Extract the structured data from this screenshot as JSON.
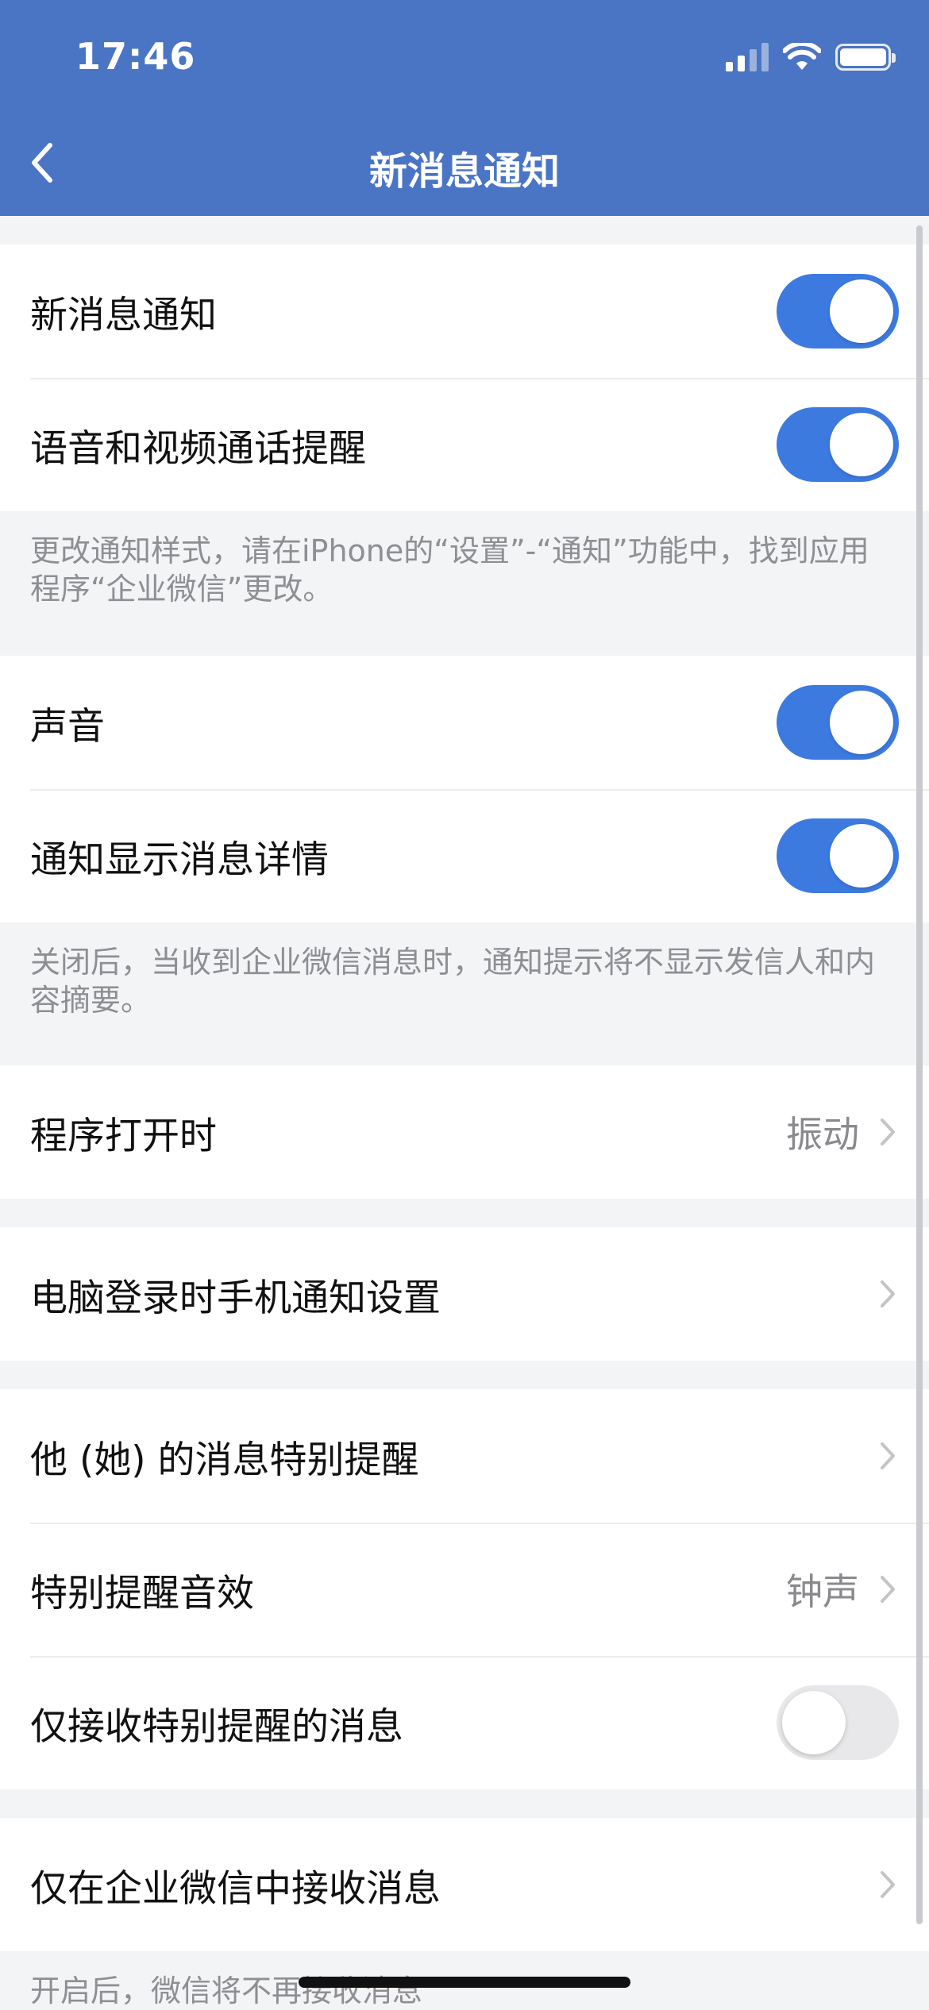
{
  "status_bar": {
    "time": "17:46"
  },
  "nav": {
    "title": "新消息通知",
    "back_icon": "chevron-left-icon"
  },
  "colors": {
    "header": "#4a74c4",
    "toggle_on": "#3d7ae0",
    "toggle_off": "#e8e8ea",
    "background": "#f3f4f6"
  },
  "groups": {
    "notify": {
      "rows": [
        {
          "label": "新消息通知",
          "toggle": true
        },
        {
          "label": "语音和视频通话提醒",
          "toggle": true
        }
      ],
      "note": "更改通知样式，请在iPhone的“设置”-“通知”功能中，找到应用程序“企业微信”更改。"
    },
    "sound": {
      "rows": [
        {
          "label": "声音",
          "toggle": true
        },
        {
          "label": "通知显示消息详情",
          "toggle": true
        }
      ],
      "note": "关闭后，当收到企业微信消息时，通知提示将不显示发信人和内容摘要。"
    },
    "app_open": {
      "label": "程序打开时",
      "value": "振动"
    },
    "pc_login": {
      "label": "电脑登录时手机通知设置"
    },
    "special": {
      "rows": [
        {
          "label": "他 (她) 的消息特别提醒"
        },
        {
          "label": "特别提醒音效",
          "value": "钟声"
        },
        {
          "label": "仅接收特别提醒的消息",
          "toggle": false
        }
      ]
    },
    "wework_only": {
      "label": "仅在企业微信中接收消息",
      "note": "开启后，微信将不再接收消息"
    }
  }
}
